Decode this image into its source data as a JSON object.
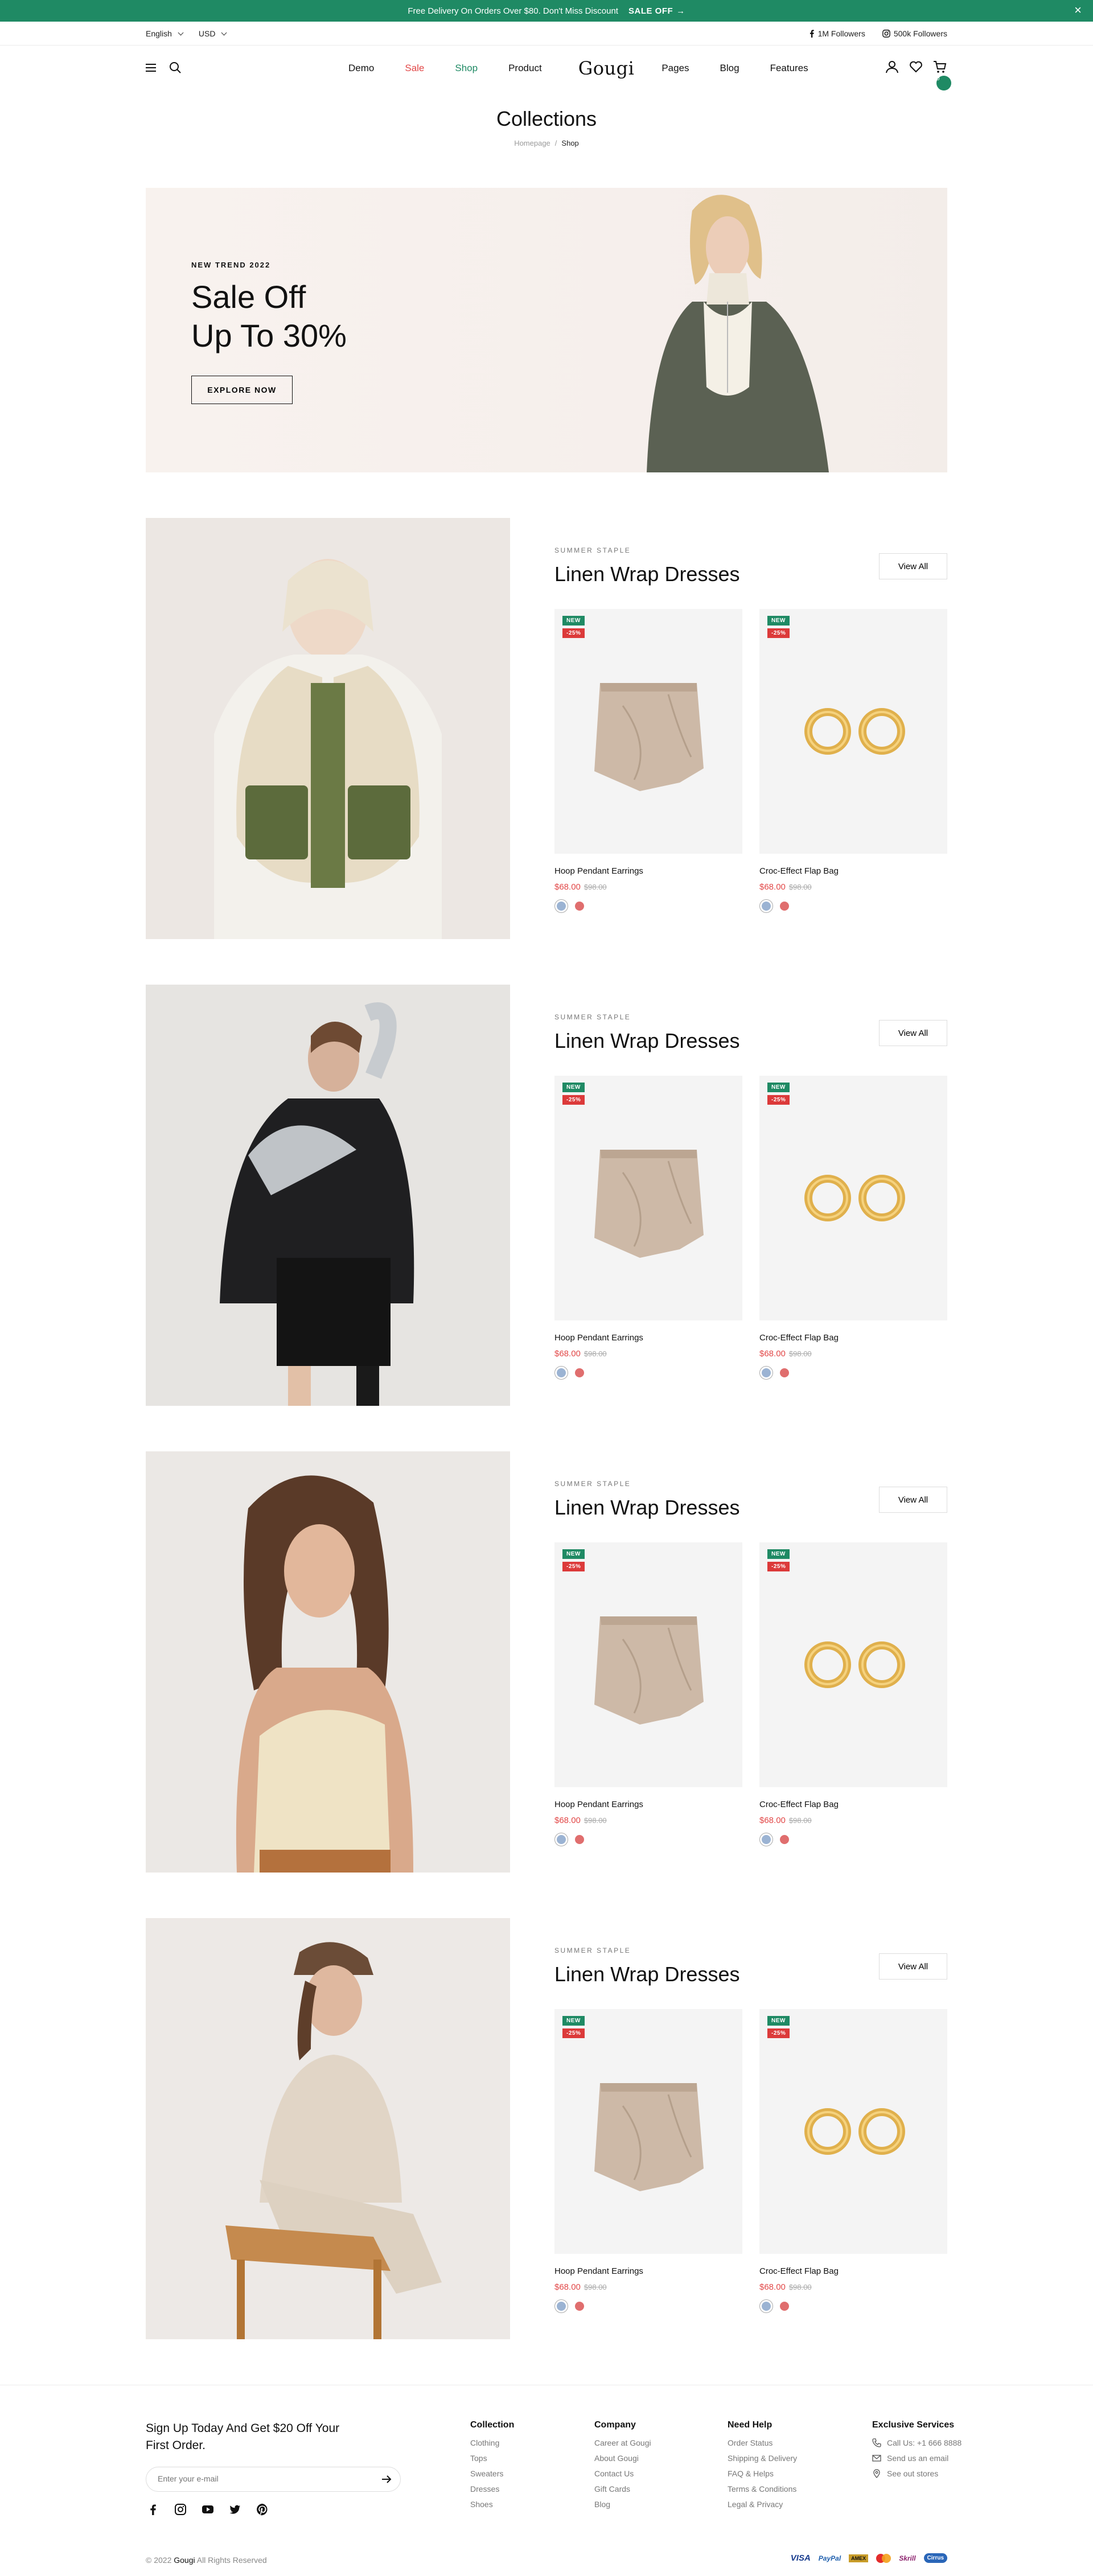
{
  "announcement": {
    "text": "Free Delivery On Orders Over $80. Don't Miss Discount",
    "link": "SALE OFF",
    "close": "×"
  },
  "utility": {
    "language": "English",
    "currency": "USD",
    "facebook_followers": "1M Followers",
    "instagram_followers": "500k Followers"
  },
  "nav": {
    "demo": "Demo",
    "sale": "Sale",
    "shop": "Shop",
    "product": "Product",
    "logo": "Gougi",
    "pages": "Pages",
    "blog": "Blog",
    "features": "Features",
    "cart_count": "0"
  },
  "colors": {
    "accent": "#1f8a64",
    "sale": "#dc3a3a",
    "price": "#e24848"
  },
  "page": {
    "title": "Collections",
    "breadcrumb_home": "Homepage",
    "breadcrumb_sep": "/",
    "breadcrumb_current": "Shop"
  },
  "hero": {
    "eyebrow": "NEW TREND 2022",
    "line1": "Sale Off",
    "line2": "Up To 30%",
    "cta": "EXPLORE NOW"
  },
  "collections": [
    {
      "eyebrow": "SUMMER STAPLE",
      "title": "Linen Wrap Dresses",
      "view_all": "View All",
      "products": [
        {
          "new": "NEW",
          "discount": "-25%",
          "name": "Hoop Pendant Earrings",
          "price": "$68.00",
          "old_price": "$98.00"
        },
        {
          "new": "NEW",
          "discount": "-25%",
          "name": "Croc-Effect Flap Bag",
          "price": "$68.00",
          "old_price": "$98.00"
        }
      ]
    },
    {
      "eyebrow": "SUMMER STAPLE",
      "title": "Linen Wrap Dresses",
      "view_all": "View All",
      "products": [
        {
          "new": "NEW",
          "discount": "-25%",
          "name": "Hoop Pendant Earrings",
          "price": "$68.00",
          "old_price": "$98.00"
        },
        {
          "new": "NEW",
          "discount": "-25%",
          "name": "Croc-Effect Flap Bag",
          "price": "$68.00",
          "old_price": "$98.00"
        }
      ]
    },
    {
      "eyebrow": "SUMMER STAPLE",
      "title": "Linen Wrap Dresses",
      "view_all": "View All",
      "products": [
        {
          "new": "NEW",
          "discount": "-25%",
          "name": "Hoop Pendant Earrings",
          "price": "$68.00",
          "old_price": "$98.00"
        },
        {
          "new": "NEW",
          "discount": "-25%",
          "name": "Croc-Effect Flap Bag",
          "price": "$68.00",
          "old_price": "$98.00"
        }
      ]
    },
    {
      "eyebrow": "SUMMER STAPLE",
      "title": "Linen Wrap Dresses",
      "view_all": "View All",
      "products": [
        {
          "new": "NEW",
          "discount": "-25%",
          "name": "Hoop Pendant Earrings",
          "price": "$68.00",
          "old_price": "$98.00"
        },
        {
          "new": "NEW",
          "discount": "-25%",
          "name": "Croc-Effect Flap Bag",
          "price": "$68.00",
          "old_price": "$98.00"
        }
      ]
    }
  ],
  "footer": {
    "newsletter_title": "Sign Up Today And Get $20 Off Your First Order.",
    "email_placeholder": "Enter your e-mail",
    "collection": {
      "title": "Collection",
      "items": [
        "Clothing",
        "Tops",
        "Sweaters",
        "Dresses",
        "Shoes"
      ]
    },
    "company": {
      "title": "Company",
      "items": [
        "Career at Gougi",
        "About Gougi",
        "Contact Us",
        "Gift Cards",
        "Blog"
      ]
    },
    "help": {
      "title": "Need Help",
      "items": [
        "Order Status",
        "Shipping & Delivery",
        "FAQ & Helps",
        "Terms & Conditions",
        "Legal & Privacy"
      ]
    },
    "services": {
      "title": "Exclusive Services",
      "items": [
        "Call Us: +1 666 8888",
        "Send us an email",
        "See out stores"
      ]
    },
    "copyright_prefix": "© 2022",
    "copyright_brand": "Gougi",
    "copyright_suffix": "All Rights Reserved",
    "payments": [
      "VISA",
      "PayPal",
      "AMEX",
      "MC",
      "Skrill",
      "Cirrus"
    ]
  }
}
